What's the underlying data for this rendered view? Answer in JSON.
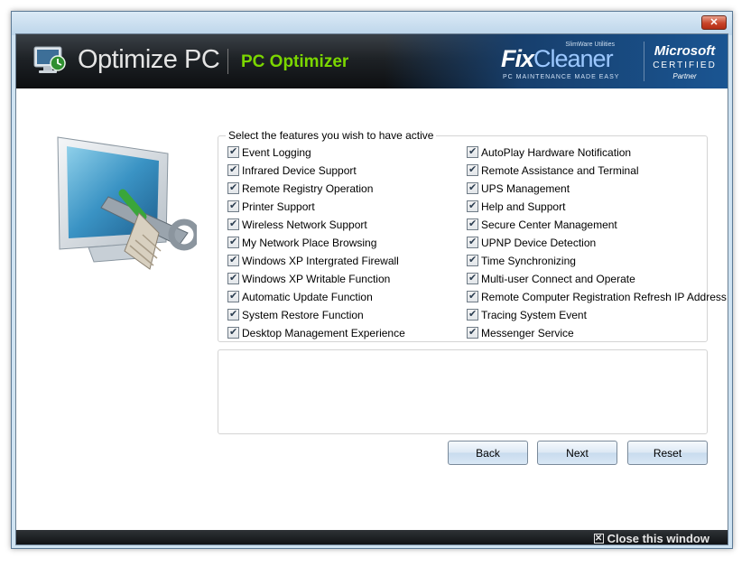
{
  "window": {
    "close_glyph": "✕"
  },
  "header": {
    "title": "Optimize PC",
    "subtitle": "PC Optimizer",
    "brand_small": "SlimWare Utilities",
    "brand_fix": "Fix",
    "brand_cleaner": "Cleaner",
    "brand_tagline": "PC MAINTENANCE MADE EASY",
    "ms_name": "Microsoft",
    "ms_certified": "CERTIFIED",
    "ms_partner": "Partner"
  },
  "features": {
    "legend": "Select the features you wish to have active",
    "left": [
      "Event Logging",
      "Infrared Device Support",
      "Remote Registry Operation",
      "Printer Support",
      "Wireless Network Support",
      "My Network Place Browsing",
      "Windows XP Intergrated Firewall",
      "Windows XP Writable Function",
      "Automatic Update Function",
      "System Restore Function",
      "Desktop Management Experience"
    ],
    "right": [
      "AutoPlay Hardware Notification",
      "Remote Assistance and Terminal",
      "UPS Management",
      "Help and Support",
      "Secure Center Management",
      "UPNP Device Detection",
      "Time Synchronizing",
      "Multi-user Connect and Operate",
      "Remote Computer Registration Refresh IP Address",
      "Tracing System Event",
      "Messenger Service"
    ]
  },
  "buttons": {
    "back": "Back",
    "next": "Next",
    "reset": "Reset"
  },
  "footer": {
    "close_label": "Close this window",
    "close_glyph": "✕"
  },
  "colors": {
    "accent_green": "#7bd600",
    "header_dark": "#1e2226",
    "header_blue": "#1a5592"
  },
  "icons": [
    "app-monitor-icon",
    "close-icon",
    "checkbox-icon",
    "monitor-tools-illustration"
  ]
}
